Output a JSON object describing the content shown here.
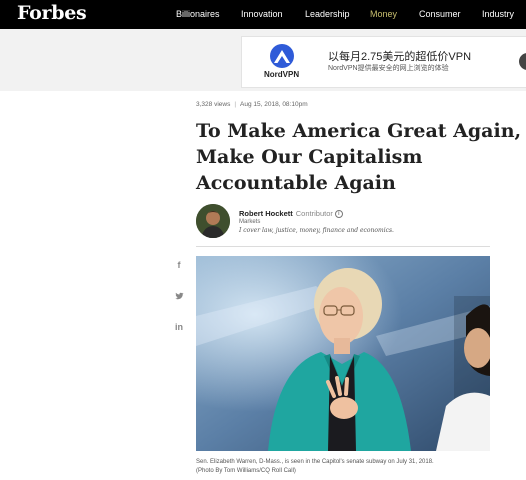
{
  "nav": {
    "logo": "Forbes",
    "items": [
      "Billionaires",
      "Innovation",
      "Leadership",
      "Money",
      "Consumer",
      "Industry"
    ],
    "active": "Money"
  },
  "ad": {
    "brand": "NordVPN",
    "title": "以每月2.75美元的超低价VPN",
    "subtitle": "NordVPN提供最安全的网上浏览的体验"
  },
  "article": {
    "views": "3,328 views",
    "date": "Aug 15, 2018, 08:10pm",
    "headline": [
      "To Make America Great Again,",
      "Make Our Capitalism",
      "Accountable Again"
    ],
    "author": {
      "name": "Robert Hockett",
      "role": "Contributor",
      "channel": "Markets",
      "bio": "I cover law, justice, money, finance and economics."
    },
    "caption": [
      "Sen. Elizabeth Warren, D-Mass., is seen in the Capitol's senate subway on July 31, 2018.",
      "(Photo By Tom Williams/CQ Roll Call)"
    ]
  },
  "share": {
    "icons": [
      "facebook-icon",
      "twitter-icon",
      "linkedin-icon"
    ],
    "glyphs": [
      "f",
      "🐦",
      "in"
    ]
  },
  "colors": {
    "nav_bg": "#000000",
    "money_accent": "#c9bf6f",
    "nordvpn_blue": "#2f5bd8",
    "jacket_teal": "#1fa6a0"
  }
}
